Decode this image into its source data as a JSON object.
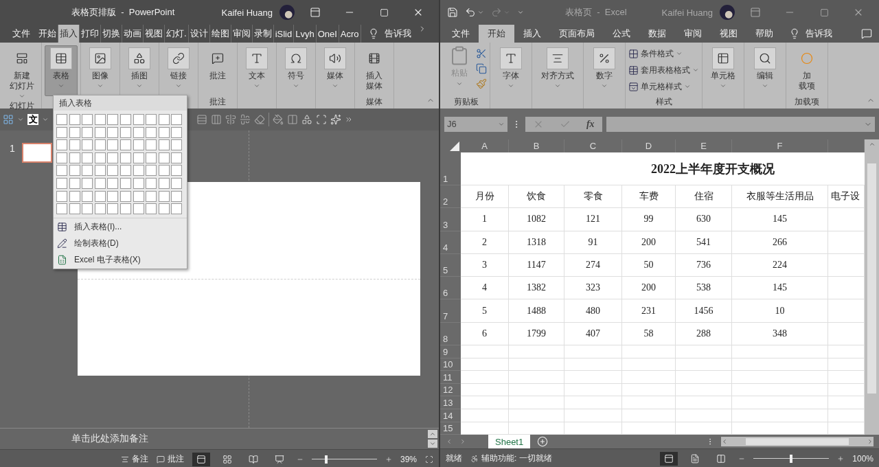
{
  "powerpoint": {
    "title": {
      "document": "表格页排版",
      "separator": "-",
      "app": "PowerPoint",
      "user": "Kaifei Huang"
    },
    "tabs": [
      {
        "label": "文件",
        "selected": false
      },
      {
        "label": "开始",
        "selected": false
      },
      {
        "label": "插入",
        "selected": true
      },
      {
        "label": "打印",
        "selected": false
      },
      {
        "label": "切换",
        "selected": false
      },
      {
        "label": "动画",
        "selected": false
      },
      {
        "label": "视图",
        "selected": false
      },
      {
        "label": "幻灯.",
        "selected": false
      },
      {
        "label": "设计",
        "selected": false
      },
      {
        "label": "绘图",
        "selected": false
      },
      {
        "label": "审阅",
        "selected": false
      },
      {
        "label": "录制",
        "selected": false
      },
      {
        "label": "iSlid",
        "selected": false
      },
      {
        "label": "Lvyh",
        "selected": false
      },
      {
        "label": "OneI",
        "selected": false
      },
      {
        "label": "Acro",
        "selected": false
      }
    ],
    "tell_me": "告诉我",
    "ribbon": [
      {
        "label": "幻灯片",
        "buttons": [
          {
            "lines": [
              "新建",
              "幻灯片"
            ],
            "caret": true,
            "selected": false
          }
        ]
      },
      {
        "buttons": [
          {
            "lines": [
              "表格"
            ],
            "caret": true,
            "selected": true
          }
        ]
      },
      {
        "buttons": [
          {
            "lines": [
              "图像"
            ],
            "caret": true,
            "selected": false
          }
        ]
      },
      {
        "buttons": [
          {
            "lines": [
              "插图"
            ],
            "caret": true,
            "selected": false
          }
        ]
      },
      {
        "buttons": [
          {
            "lines": [
              "链接"
            ],
            "caret": true,
            "selected": false
          }
        ]
      },
      {
        "label": "批注",
        "buttons": [
          {
            "lines": [
              "批注"
            ],
            "caret": false,
            "selected": false
          }
        ]
      },
      {
        "buttons": [
          {
            "lines": [
              "文本"
            ],
            "caret": true,
            "selected": false
          }
        ]
      },
      {
        "buttons": [
          {
            "lines": [
              "符号"
            ],
            "caret": true,
            "selected": false
          }
        ]
      },
      {
        "buttons": [
          {
            "lines": [
              "媒体"
            ],
            "caret": true,
            "selected": false
          }
        ]
      },
      {
        "label": "媒体",
        "buttons": [
          {
            "lines": [
              "插入",
              "媒体"
            ],
            "caret": false,
            "selected": false
          }
        ]
      }
    ],
    "format_bar": {
      "text_button": "文"
    },
    "table_menu": {
      "title": "插入表格",
      "items": [
        {
          "label": "插入表格(I)..."
        },
        {
          "label": "绘制表格(D)"
        },
        {
          "label": "Excel 电子表格(X)"
        }
      ]
    },
    "slides": [
      {
        "number": "1",
        "selected": true
      }
    ],
    "notes_placeholder": "单击此处添加备注",
    "status": {
      "notes": "备注",
      "comments": "批注",
      "zoom": "39%",
      "zoom_slider": {
        "level": 0.22
      },
      "views": [
        {
          "selected": true
        },
        {
          "selected": false
        },
        {
          "selected": false
        },
        {
          "selected": false
        }
      ]
    }
  },
  "excel": {
    "title": {
      "document": "表格页",
      "separator": "-",
      "app": "Excel",
      "user": "Kaifei Huang"
    },
    "tabs": [
      {
        "label": "文件",
        "selected": false
      },
      {
        "label": "开始",
        "selected": true
      },
      {
        "label": "插入",
        "selected": false
      },
      {
        "label": "页面布局",
        "selected": false
      },
      {
        "label": "公式",
        "selected": false
      },
      {
        "label": "数据",
        "selected": false
      },
      {
        "label": "审阅",
        "selected": false
      },
      {
        "label": "视图",
        "selected": false
      },
      {
        "label": "帮助",
        "selected": false
      }
    ],
    "tell_me": "告诉我",
    "ribbon": [
      {
        "kind": "clipboard",
        "label": "剪贴板",
        "paste": {
          "label": "粘贴",
          "disabled": true
        }
      },
      {
        "kind": "big",
        "buttons": [
          {
            "lines": [
              "字体"
            ],
            "caret": true
          }
        ]
      },
      {
        "kind": "big",
        "buttons": [
          {
            "lines": [
              "对齐方式"
            ],
            "caret": true
          }
        ]
      },
      {
        "kind": "big",
        "buttons": [
          {
            "lines": [
              "数字"
            ],
            "caret": true
          }
        ]
      },
      {
        "kind": "list",
        "label": "样式",
        "items": [
          {
            "label": "条件格式"
          },
          {
            "label": "套用表格格式"
          },
          {
            "label": "单元格样式"
          }
        ]
      },
      {
        "kind": "big",
        "buttons": [
          {
            "lines": [
              "单元格"
            ],
            "caret": true
          }
        ]
      },
      {
        "kind": "big",
        "buttons": [
          {
            "lines": [
              "编辑"
            ],
            "caret": true
          }
        ]
      },
      {
        "kind": "big",
        "label": "加载项",
        "buttons": [
          {
            "lines": [
              "加",
              "载项"
            ],
            "caret": false
          }
        ]
      }
    ],
    "name_box": "J6",
    "function_label": "fx",
    "sheet": {
      "columns": [
        "A",
        "B",
        "C",
        "D",
        "E",
        "F"
      ],
      "rows": [
        {
          "number": "1",
          "kind": "title",
          "cells": [
            "2022上半年度开支概况"
          ]
        },
        {
          "number": "2",
          "kind": "data",
          "cells": [
            "月份",
            "饮食",
            "零食",
            "车费",
            "住宿",
            "衣服等生活用品",
            "电子设"
          ]
        },
        {
          "number": "3",
          "kind": "data",
          "cells": [
            "1",
            "1082",
            "121",
            "99",
            "630",
            "145"
          ]
        },
        {
          "number": "4",
          "kind": "data",
          "cells": [
            "2",
            "1318",
            "91",
            "200",
            "541",
            "266"
          ]
        },
        {
          "number": "5",
          "kind": "data",
          "cells": [
            "3",
            "1147",
            "274",
            "50",
            "736",
            "224"
          ]
        },
        {
          "number": "6",
          "kind": "data",
          "cells": [
            "4",
            "1382",
            "323",
            "200",
            "538",
            "145"
          ]
        },
        {
          "number": "7",
          "kind": "data",
          "cells": [
            "5",
            "1488",
            "480",
            "231",
            "1456",
            "10"
          ]
        },
        {
          "number": "8",
          "kind": "data",
          "cells": [
            "6",
            "1799",
            "407",
            "58",
            "288",
            "348"
          ]
        },
        {
          "number": "9",
          "kind": "empty"
        },
        {
          "number": "10",
          "kind": "empty"
        },
        {
          "number": "11",
          "kind": "empty"
        },
        {
          "number": "12",
          "kind": "empty"
        },
        {
          "number": "13",
          "kind": "empty"
        },
        {
          "number": "14",
          "kind": "empty"
        },
        {
          "number": "15",
          "kind": "empty"
        }
      ]
    },
    "sheet_tabs": [
      {
        "label": "Sheet1",
        "selected": true
      }
    ],
    "status": {
      "ready": "就绪",
      "accessibility": "辅助功能: 一切就绪",
      "zoom": "100%",
      "zoom_slider": {
        "level": 0.5
      },
      "views": [
        {
          "selected": true
        },
        {
          "selected": false
        },
        {
          "selected": false
        }
      ]
    }
  }
}
